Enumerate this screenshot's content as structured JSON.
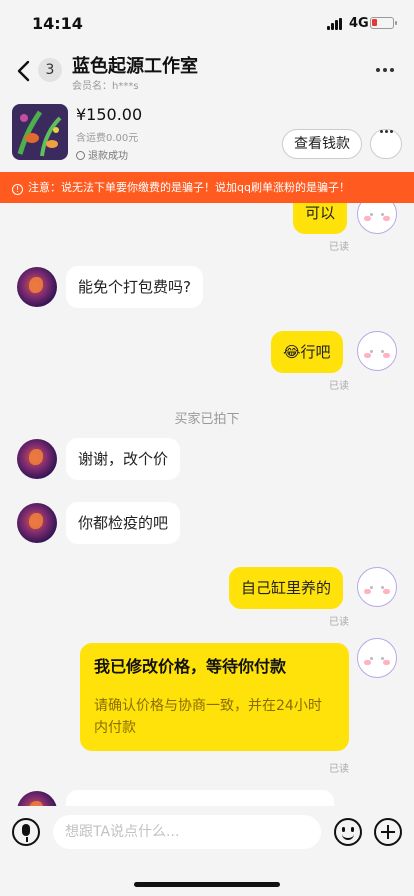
{
  "status": {
    "time": "14:14",
    "network": "4G"
  },
  "header": {
    "unread_count": "3",
    "title": "蓝色起源工作室",
    "member_label": "会员名：h***s"
  },
  "product": {
    "price": "¥150.00",
    "shipping": "含运费0.00元",
    "status": "退款成功",
    "wallet_button": "查看钱款"
  },
  "notice": {
    "text": "注意：说无法下单要你缴费的是骗子！说加qq刷单涨粉的是骗子！"
  },
  "messages": {
    "m1": {
      "text": "可以",
      "read": "已读"
    },
    "m2": {
      "text": "能免个打包费吗?"
    },
    "m3": {
      "emoji": "😂",
      "text": "行吧",
      "read": "已读"
    },
    "system": "买家已拍下",
    "m4": {
      "text": "谢谢，改个价"
    },
    "m5": {
      "text": "你都检疫的吧"
    },
    "m6": {
      "text": "自己缸里养的",
      "read": "已读"
    },
    "card": {
      "title": "我已修改价格，等待你付款",
      "desc": "请确认价格与协商一致，并在24小时内付款",
      "read": "已读"
    }
  },
  "input": {
    "placeholder": "想跟TA说点什么..."
  },
  "colors": {
    "accent": "#ffe20a",
    "notice": "#ff5a1f"
  }
}
